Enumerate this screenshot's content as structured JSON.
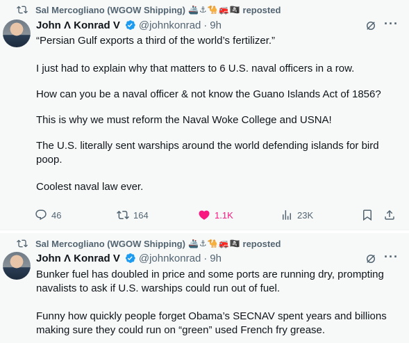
{
  "posts": [
    {
      "repost": {
        "by": "Sal Mercogliano (WGOW Shipping)",
        "emojis": [
          "🚢",
          "⚓",
          "🐪",
          "🚒",
          "🏴‍☠️"
        ],
        "label": "reposted"
      },
      "author": {
        "name": "John Λ Konrad V",
        "handle": "@johnkonrad",
        "dot": "·",
        "time": "9h"
      },
      "paragraphs": [
        "“Persian Gulf exports a third of the world’s fertilizer.”",
        "I just had to explain why that matters to 6 U.S. naval officers in a row.",
        "How can you be a naval officer & not know the Guano Islands Act of 1856?",
        "This is why we must reform the Naval Woke College and USNA!",
        "The U.S. literally sent warships around the world defending islands for bird poop.",
        "Coolest naval law ever."
      ],
      "stats": {
        "replies": "46",
        "reposts": "164",
        "likes": "1.1K",
        "views": "23K"
      }
    },
    {
      "repost": {
        "by": "Sal Mercogliano (WGOW Shipping)",
        "emojis": [
          "🚢",
          "⚓",
          "🐪",
          "🚒",
          "🏴‍☠️"
        ],
        "label": "reposted"
      },
      "author": {
        "name": "John Λ Konrad V",
        "handle": "@johnkonrad",
        "dot": "·",
        "time": "9h"
      },
      "paragraphs": [
        "Bunker fuel has doubled in price and some ports are running dry, prompting navalists to ask if U.S. warships could run out of fuel.",
        "Funny how quickly people forget Obama’s SECNAV spent years and billions making sure they could run on “green” used French fry grease."
      ]
    }
  ],
  "colors": {
    "text": "#0f1419",
    "muted": "#536471",
    "like": "#f91880",
    "verified": "#1d9bf0",
    "background": "#f7f9f9"
  },
  "icons": [
    "repost-icon",
    "verified-badge-icon",
    "grok-icon",
    "more-icon",
    "reply-icon",
    "retweet-icon",
    "like-icon",
    "views-icon",
    "bookmark-icon",
    "share-icon"
  ]
}
